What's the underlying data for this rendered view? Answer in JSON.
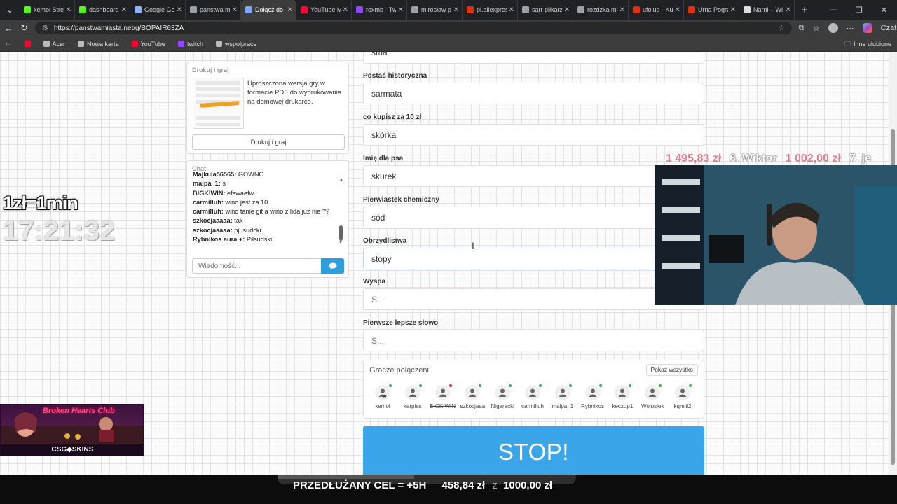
{
  "browser": {
    "tabs": [
      {
        "title": "kemol Strea",
        "color": "#53fc18",
        "active": false
      },
      {
        "title": "dashboard",
        "color": "#53fc18",
        "active": false
      },
      {
        "title": "Google Gem",
        "color": "#8ab4f8",
        "active": false
      },
      {
        "title": "panstwa mi",
        "color": "#9aa0a6",
        "active": false
      },
      {
        "title": "Dołącz do",
        "color": "#7aa7ff",
        "active": true
      },
      {
        "title": "YouTube M",
        "color": "#ff0033",
        "active": false
      },
      {
        "title": "roxmb - Tw",
        "color": "#9146ff",
        "active": false
      },
      {
        "title": "mirosław p",
        "color": "#9aa0a6",
        "active": false
      },
      {
        "title": "pl.aliexpres",
        "color": "#e62e04",
        "active": false
      },
      {
        "title": "sarr piłkarz",
        "color": "#9aa0a6",
        "active": false
      },
      {
        "title": "rozdzka mi",
        "color": "#9aa0a6",
        "active": false
      },
      {
        "title": "ufolud - Ku",
        "color": "#e62e04",
        "active": false
      },
      {
        "title": "Urna Pogrz",
        "color": "#e62e04",
        "active": false
      },
      {
        "title": "Narni – Wik",
        "color": "#dddddd",
        "active": false
      }
    ],
    "url": "https://panstwamiasta.net/g/BOPAIR63ZA",
    "profile_label": "Czat",
    "bookmarks": [
      {
        "label": "Acer",
        "color": "#bbbbbb"
      },
      {
        "label": "Nowa karta",
        "color": "#bbbbbb"
      },
      {
        "label": "YouTube",
        "color": "#ff0033"
      },
      {
        "label": "twitch",
        "color": "#9146ff"
      },
      {
        "label": "wspolprace",
        "color": "#bbbbbb"
      }
    ],
    "bookmarks_other": "Inne ulubione"
  },
  "print_panel": {
    "title": "Drukuj i graj",
    "description": "Uproszczona wersja gry w formacie PDF do wydrukowania na domowej drukarce.",
    "button": "Drukuj i graj"
  },
  "chat": {
    "title": "Chat",
    "messages": [
      {
        "nick": "Majkula56565:",
        "text": "GOWNO"
      },
      {
        "nick": "malpa_1:",
        "text": "s"
      },
      {
        "nick": "BIGKIWIN:",
        "text": "efswaefw"
      },
      {
        "nick": "carmilluh:",
        "text": "wino jest za 10"
      },
      {
        "nick": "carmilluh:",
        "text": "wino tanie git a wino z lida juz nie ??"
      },
      {
        "nick": "szkocjaaaaa:",
        "text": "tak"
      },
      {
        "nick": "szkocjaaaaa:",
        "text": "pjusudcki"
      },
      {
        "nick": "Rybnikos aura +:",
        "text": "Piłsudski"
      }
    ],
    "input_placeholder": "Wiadomość..."
  },
  "form": {
    "top_partial_value": "sma",
    "fields": [
      {
        "label": "Postać historyczna",
        "value": "sarmata",
        "placeholder": ""
      },
      {
        "label": "co kupisz za 10 zł",
        "value": "skórka",
        "placeholder": ""
      },
      {
        "label": "Imię dla psa",
        "value": "skurek",
        "placeholder": ""
      },
      {
        "label": "Pierwiastek chemiczny",
        "value": "sód",
        "placeholder": ""
      },
      {
        "label": "Obrzydlistwa",
        "value": "stopy",
        "placeholder": ""
      },
      {
        "label": "Wyspa",
        "value": "",
        "placeholder": "S..."
      },
      {
        "label": "Pierwsze lepsze słowo",
        "value": "",
        "placeholder": "S..."
      }
    ]
  },
  "players": {
    "title": "Gracze połączeni",
    "show_all": "Pokaż wszystko",
    "list": [
      {
        "name": "kemol",
        "status": "online",
        "host": true
      },
      {
        "name": "karpies",
        "status": "online",
        "host": false
      },
      {
        "name": "BIGKIWIN",
        "status": "offline",
        "host": false
      },
      {
        "name": "szkocjaaa",
        "status": "online",
        "host": false
      },
      {
        "name": "Nigerecki",
        "status": "online",
        "host": false
      },
      {
        "name": "carmilluh",
        "status": "online",
        "host": false
      },
      {
        "name": "malpa_1",
        "status": "online",
        "host": false
      },
      {
        "name": "Rybnikos",
        "status": "online",
        "host": false
      },
      {
        "name": "keczup1",
        "status": "online",
        "host": false
      },
      {
        "name": "Wojusiek",
        "status": "online",
        "host": false
      },
      {
        "name": "kqmiii2",
        "status": "online",
        "host": false
      }
    ]
  },
  "stop_button": "STOP!",
  "stream": {
    "rate": "1zł=1min",
    "timer": "17:21:32",
    "leaderboard": [
      {
        "amount": "1 495,83 zł",
        "name": "6. Wiktor"
      },
      {
        "amount": "1 002,00 zł",
        "name": "7. je"
      }
    ],
    "promo_title": "Broken Hearts Club",
    "promo_brand": "CSG◆SKINS",
    "goal_label": "PRZEDŁUŻANY CEL = +5H",
    "goal_current": "458,84 zł",
    "goal_sep": "z",
    "goal_target": "1000,00 zł",
    "goal_fraction": 0.4588
  }
}
